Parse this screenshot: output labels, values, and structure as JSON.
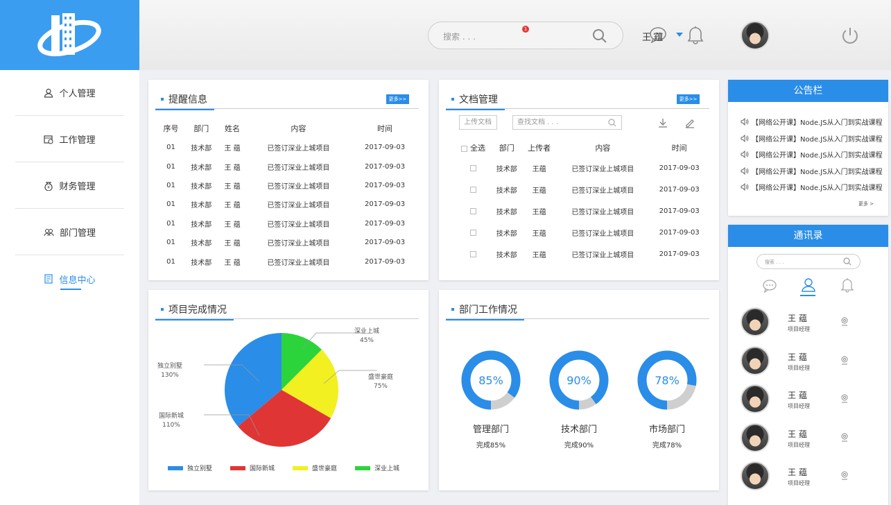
{
  "header": {
    "search_placeholder": "搜索 . . .",
    "notification_count": "1",
    "user_name": "王 蕴"
  },
  "sidebar": {
    "items": [
      {
        "label": "个人管理",
        "icon": "user-icon"
      },
      {
        "label": "工作管理",
        "icon": "calendar-icon"
      },
      {
        "label": "财务管理",
        "icon": "money-bag-icon"
      },
      {
        "label": "部门管理",
        "icon": "group-icon"
      },
      {
        "label": "信息中心",
        "icon": "document-icon",
        "active": true
      }
    ]
  },
  "reminders": {
    "title": "提醒信息",
    "more": "更多>>",
    "columns": [
      "序号",
      "部门",
      "姓名",
      "内容",
      "时间"
    ],
    "rows": [
      [
        "01",
        "技术部",
        "王 蕴",
        "已签订深业上城项目",
        "2017-09-03"
      ],
      [
        "01",
        "技术部",
        "王 蕴",
        "已签订深业上城项目",
        "2017-09-03"
      ],
      [
        "01",
        "技术部",
        "王 蕴",
        "已签订深业上城项目",
        "2017-09-03"
      ],
      [
        "01",
        "技术部",
        "王 蕴",
        "已签订深业上城项目",
        "2017-09-03"
      ],
      [
        "01",
        "技术部",
        "王 蕴",
        "已签订深业上城项目",
        "2017-09-03"
      ],
      [
        "01",
        "技术部",
        "王 蕴",
        "已签订深业上城项目",
        "2017-09-03"
      ],
      [
        "01",
        "技术部",
        "王 蕴",
        "已签订深业上城项目",
        "2017-09-03"
      ]
    ]
  },
  "documents": {
    "title": "文档管理",
    "more": "更多>>",
    "upload_label": "上传文档",
    "search_placeholder": "查找文档 . . .",
    "columns": [
      "全选",
      "部门",
      "上传者",
      "内容",
      "时间"
    ],
    "rows": [
      [
        "技术部",
        "王蕴",
        "已签订深业上城项目",
        "2017-09-03"
      ],
      [
        "技术部",
        "王蕴",
        "已签订深业上城项目",
        "2017-09-03"
      ],
      [
        "技术部",
        "王蕴",
        "已签订深业上城项目",
        "2017-09-03"
      ],
      [
        "技术部",
        "王蕴",
        "已签订深业上城项目",
        "2017-09-03"
      ],
      [
        "技术部",
        "王蕴",
        "已签订深业上城项目",
        "2017-09-03"
      ]
    ]
  },
  "projects": {
    "title": "项目完成情况",
    "slices": [
      {
        "name": "深业上城",
        "label": "45%",
        "color": "#2cd43c",
        "share": 0.125
      },
      {
        "name": "盛世豪庭",
        "label": "75%",
        "color": "#f2f020",
        "share": 0.208
      },
      {
        "name": "国际新城",
        "label": "110%",
        "color": "#e03535",
        "share": 0.306
      },
      {
        "name": "独立别墅",
        "label": "130%",
        "color": "#2a8de8",
        "share": 0.361
      }
    ],
    "legend": [
      "独立别墅",
      "国际新城",
      "盛世豪庭",
      "深业上城"
    ]
  },
  "departments": {
    "title": "部门工作情况",
    "items": [
      {
        "pct": "85%",
        "value": 0.85,
        "name": "管理部门",
        "sub": "完成85%"
      },
      {
        "pct": "90%",
        "value": 0.9,
        "name": "技术部门",
        "sub": "完成90%"
      },
      {
        "pct": "78%",
        "value": 0.78,
        "name": "市场部门",
        "sub": "完成78%"
      }
    ],
    "colors": {
      "fill": "#2a8de8",
      "rest": "#cfcfcf"
    }
  },
  "board": {
    "title": "公告栏",
    "items": [
      "【网络公开课】Node.JS从入门到实战课程",
      "【网络公开课】Node.JS从入门到实战课程",
      "【网络公开课】Node.JS从入门到实战课程",
      "【网络公开课】Node.JS从入门到实战课程",
      "【网络公开课】Node.JS从入门到实战课程"
    ],
    "more": "更多 >"
  },
  "contacts": {
    "title": "通讯录",
    "search_placeholder": "搜索 . . .",
    "items": [
      {
        "name": "王 蕴",
        "role": "项目经理"
      },
      {
        "name": "王 蕴",
        "role": "项目经理"
      },
      {
        "name": "王 蕴",
        "role": "项目经理"
      },
      {
        "name": "王 蕴",
        "role": "项目经理"
      },
      {
        "name": "王 蕴",
        "role": "项目经理"
      }
    ]
  }
}
